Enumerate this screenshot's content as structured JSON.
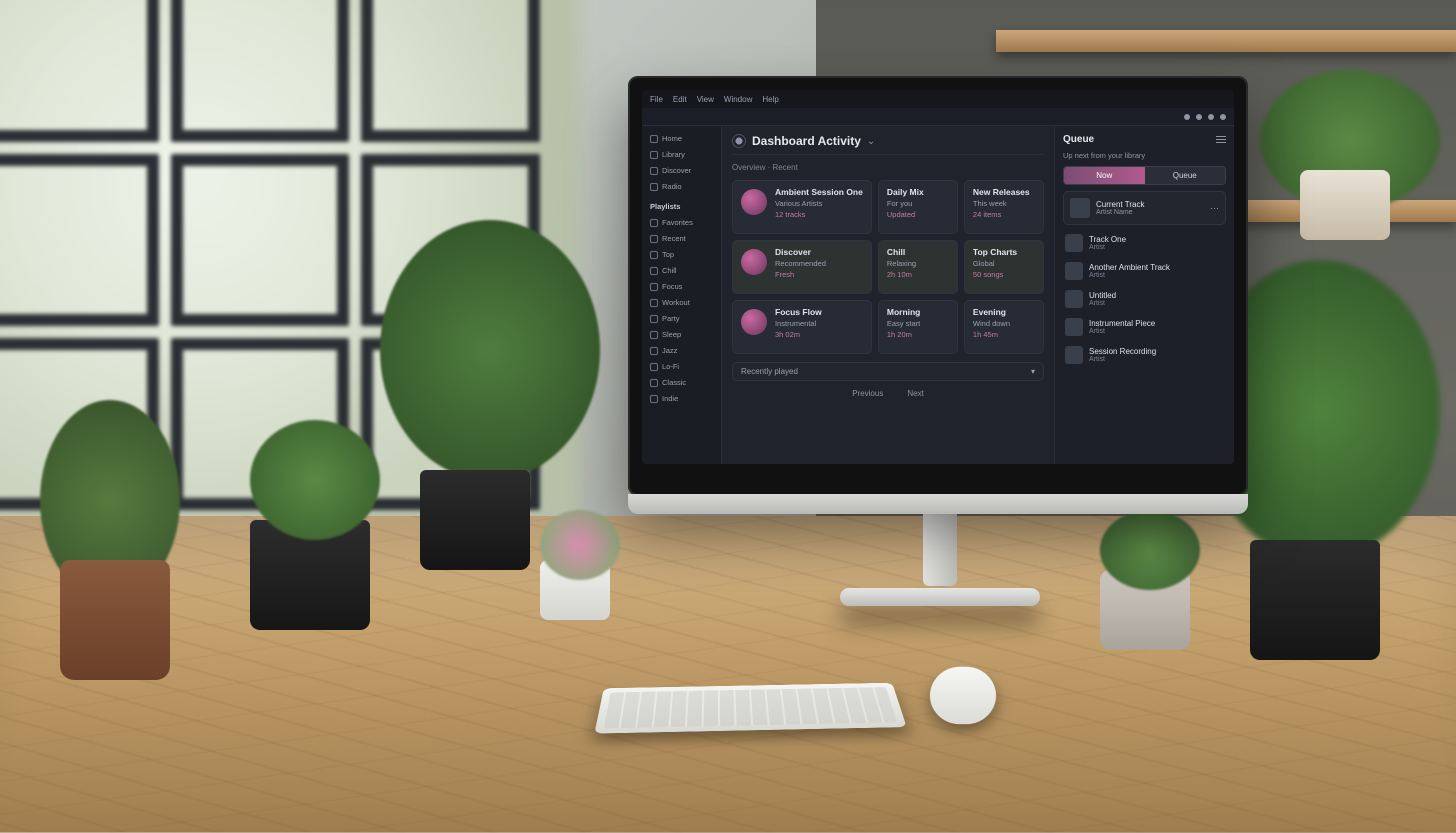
{
  "menubar": {
    "items": [
      "File",
      "Edit",
      "View",
      "Window",
      "Help"
    ]
  },
  "header": {
    "title": "Dashboard Activity",
    "breadcrumb": "Overview · Recent"
  },
  "sidebar": {
    "sections": [
      {
        "label": "Home"
      },
      {
        "label": "Library"
      },
      {
        "label": "Discover"
      },
      {
        "label": "Radio"
      }
    ],
    "groupLabel": "Playlists",
    "items": [
      {
        "label": "Favorites"
      },
      {
        "label": "Recent"
      },
      {
        "label": "Top"
      },
      {
        "label": "Chill"
      },
      {
        "label": "Focus"
      },
      {
        "label": "Workout"
      },
      {
        "label": "Party"
      },
      {
        "label": "Sleep"
      },
      {
        "label": "Jazz"
      },
      {
        "label": "Lo-Fi"
      },
      {
        "label": "Classic"
      },
      {
        "label": "Indie"
      }
    ]
  },
  "cards": [
    {
      "title": "Ambient Session One",
      "sub": "Various Artists",
      "meta": "12 tracks"
    },
    {
      "title": "Daily Mix",
      "sub": "For you",
      "meta": "Updated"
    },
    {
      "title": "New Releases",
      "sub": "This week",
      "meta": "24 items"
    },
    {
      "title": "Discover",
      "sub": "Recommended",
      "meta": "Fresh"
    },
    {
      "title": "Chill",
      "sub": "Relaxing",
      "meta": "2h 10m"
    },
    {
      "title": "Top Charts",
      "sub": "Global",
      "meta": "50 songs"
    },
    {
      "title": "Focus Flow",
      "sub": "Instrumental",
      "meta": "3h 02m"
    },
    {
      "title": "Morning",
      "sub": "Easy start",
      "meta": "1h 20m"
    },
    {
      "title": "Evening",
      "sub": "Wind down",
      "meta": "1h 45m"
    }
  ],
  "footer": {
    "label": "Recently played"
  },
  "pager": {
    "a": "Previous",
    "b": "Next"
  },
  "right": {
    "title": "Queue",
    "subtitle": "Up next from your library",
    "tabs": {
      "a": "Now",
      "b": "Queue"
    },
    "now": {
      "title": "Current Track",
      "sub": "Artist Name"
    },
    "items": [
      {
        "title": "Track One",
        "sub": "Artist"
      },
      {
        "title": "Another Ambient Track",
        "sub": "Artist"
      },
      {
        "title": "Untitled",
        "sub": "Artist"
      },
      {
        "title": "Instrumental Piece",
        "sub": "Artist"
      },
      {
        "title": "Session Recording",
        "sub": "Artist"
      }
    ]
  }
}
